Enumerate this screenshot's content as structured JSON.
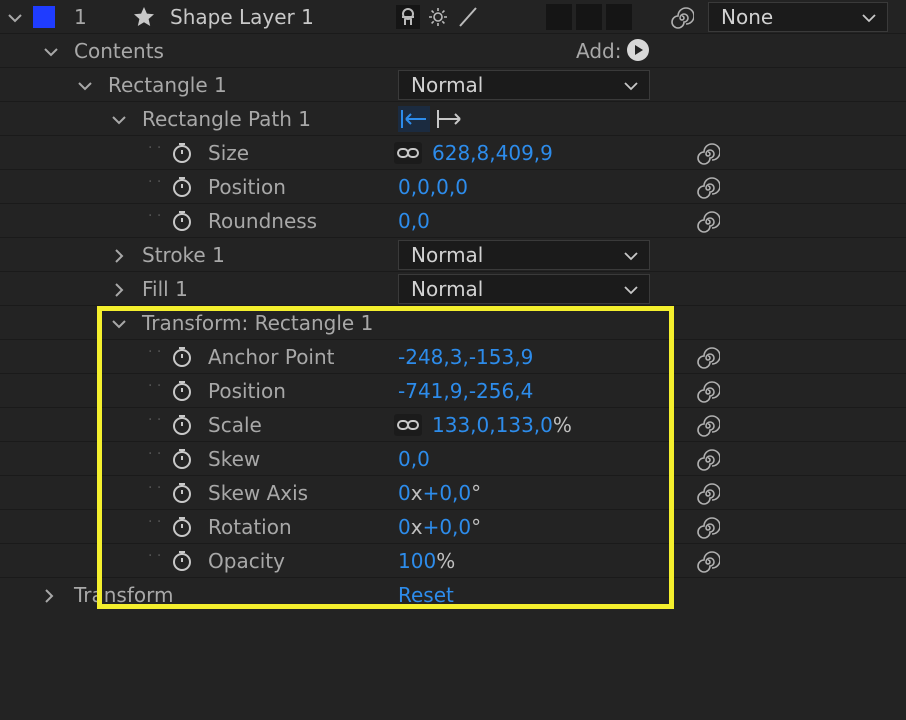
{
  "layer": {
    "number": "1",
    "name": "Shape Layer 1",
    "parent": "None",
    "color": "#1f3cff"
  },
  "contents": {
    "label": "Contents",
    "add_label": "Add:"
  },
  "rectangle": {
    "label": "Rectangle 1",
    "blend": "Normal"
  },
  "path": {
    "label": "Rectangle Path 1",
    "props": [
      {
        "name": "Size",
        "value": "628,8,409,9",
        "unit": "",
        "linked": true
      },
      {
        "name": "Position",
        "value": "0,0,0,0",
        "unit": ""
      },
      {
        "name": "Roundness",
        "value": "0,0",
        "unit": ""
      }
    ]
  },
  "stroke": {
    "label": "Stroke 1",
    "blend": "Normal"
  },
  "fill": {
    "label": "Fill 1",
    "blend": "Normal"
  },
  "transform_rect": {
    "label": "Transform: Rectangle 1",
    "props": [
      {
        "name": "Anchor Point",
        "value": "-248,3,-153,9"
      },
      {
        "name": "Position",
        "value": "-741,9,-256,4"
      },
      {
        "name": "Scale",
        "value": "133,0,133,0",
        "unit": "%"
      },
      {
        "name": "Skew",
        "value": "0,0"
      },
      {
        "name": "Skew Axis",
        "prefix": "0",
        "x": "x",
        "value": "+0,0",
        "unit": "°"
      },
      {
        "name": "Rotation",
        "prefix": "0",
        "x": "x",
        "value": "+0,0",
        "unit": "°"
      },
      {
        "name": "Opacity",
        "value": "100",
        "unit": "%"
      }
    ]
  },
  "transform": {
    "label": "Transform",
    "reset": "Reset"
  },
  "colors": {
    "accent": "#2d8ceb",
    "highlight": "#f4ef2d",
    "bg": "#232323"
  }
}
